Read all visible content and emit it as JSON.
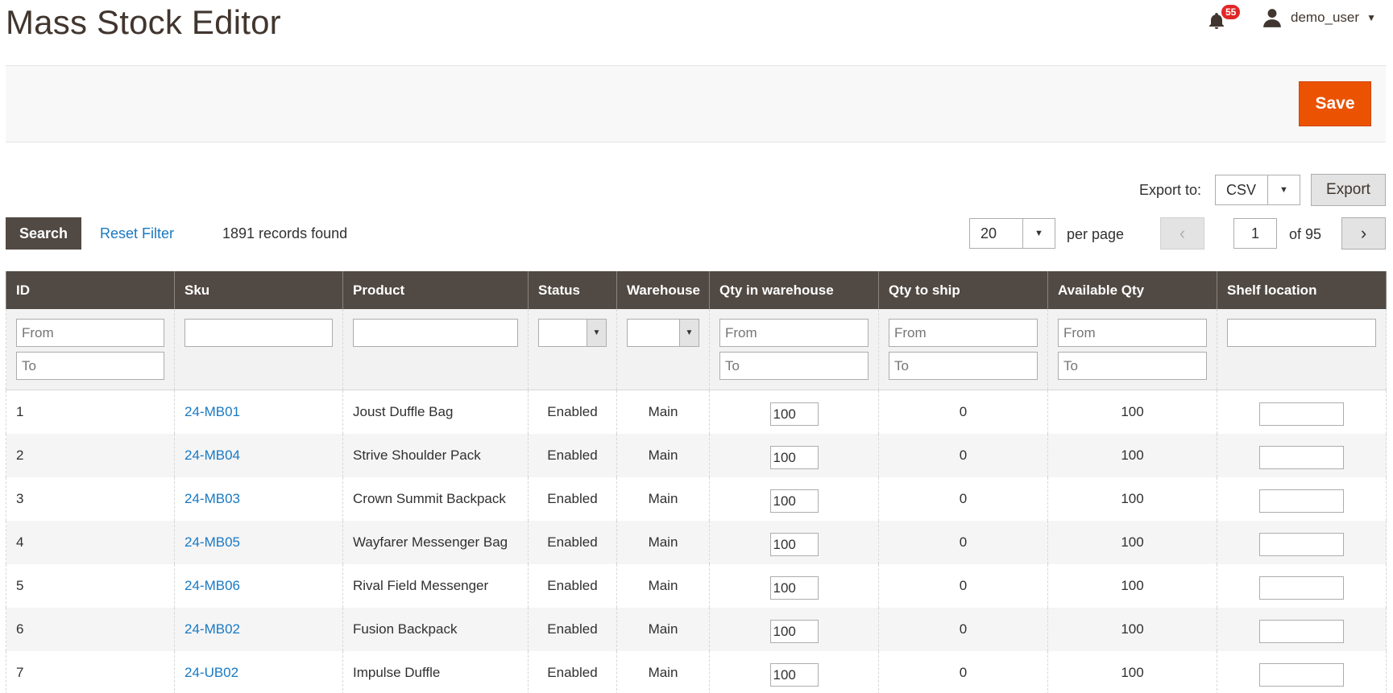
{
  "header": {
    "title": "Mass Stock Editor",
    "notifications_count": "55",
    "username": "demo_user"
  },
  "actions": {
    "save_label": "Save"
  },
  "export": {
    "label": "Export to:",
    "format": "CSV",
    "button_label": "Export"
  },
  "toolbar": {
    "search_label": "Search",
    "reset_label": "Reset Filter",
    "records_found": "1891 records found",
    "per_page_value": "20",
    "per_page_label": "per page",
    "current_page": "1",
    "of_pages": "of 95"
  },
  "table": {
    "columns": [
      "ID",
      "Sku",
      "Product",
      "Status",
      "Warehouse",
      "Qty in warehouse",
      "Qty to ship",
      "Available Qty",
      "Shelf location"
    ],
    "filters": {
      "from_placeholder": "From",
      "to_placeholder": "To"
    },
    "rows": [
      {
        "id": "1",
        "sku": "24-MB01",
        "product": "Joust Duffle Bag",
        "status": "Enabled",
        "warehouse": "Main",
        "qty_in_warehouse": "100",
        "qty_to_ship": "0",
        "available_qty": "100",
        "shelf": ""
      },
      {
        "id": "2",
        "sku": "24-MB04",
        "product": "Strive Shoulder Pack",
        "status": "Enabled",
        "warehouse": "Main",
        "qty_in_warehouse": "100",
        "qty_to_ship": "0",
        "available_qty": "100",
        "shelf": ""
      },
      {
        "id": "3",
        "sku": "24-MB03",
        "product": "Crown Summit Backpack",
        "status": "Enabled",
        "warehouse": "Main",
        "qty_in_warehouse": "100",
        "qty_to_ship": "0",
        "available_qty": "100",
        "shelf": ""
      },
      {
        "id": "4",
        "sku": "24-MB05",
        "product": "Wayfarer Messenger Bag",
        "status": "Enabled",
        "warehouse": "Main",
        "qty_in_warehouse": "100",
        "qty_to_ship": "0",
        "available_qty": "100",
        "shelf": ""
      },
      {
        "id": "5",
        "sku": "24-MB06",
        "product": "Rival Field Messenger",
        "status": "Enabled",
        "warehouse": "Main",
        "qty_in_warehouse": "100",
        "qty_to_ship": "0",
        "available_qty": "100",
        "shelf": ""
      },
      {
        "id": "6",
        "sku": "24-MB02",
        "product": "Fusion Backpack",
        "status": "Enabled",
        "warehouse": "Main",
        "qty_in_warehouse": "100",
        "qty_to_ship": "0",
        "available_qty": "100",
        "shelf": ""
      },
      {
        "id": "7",
        "sku": "24-UB02",
        "product": "Impulse Duffle",
        "status": "Enabled",
        "warehouse": "Main",
        "qty_in_warehouse": "100",
        "qty_to_ship": "0",
        "available_qty": "100",
        "shelf": ""
      }
    ]
  },
  "colors": {
    "accent": "#eb5202",
    "header_bg": "#514943",
    "link": "#1979c3",
    "badge": "#e22626"
  }
}
